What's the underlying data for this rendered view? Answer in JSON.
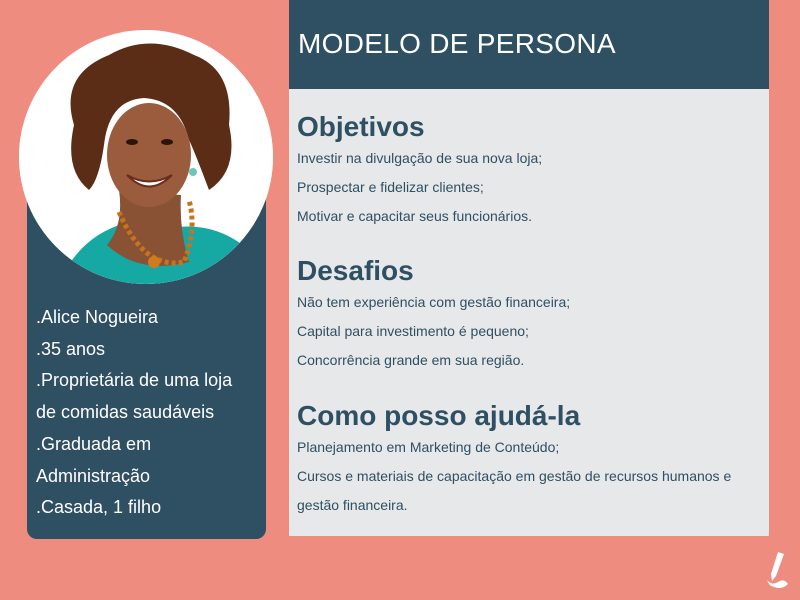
{
  "header": {
    "title": "MODELO DE PERSONA"
  },
  "profile": {
    "lines": [
      ".Alice Nogueira",
      ".35 anos",
      ".Proprietária de uma loja",
      "de comidas saudáveis",
      ".Graduada em",
      "Administração",
      ".Casada, 1 filho"
    ]
  },
  "sections": [
    {
      "heading": "Objetivos",
      "items": [
        "Investir na divulgação de sua nova loja;",
        "Prospectar e fidelizar clientes;",
        "Motivar e capacitar seus funcionários."
      ]
    },
    {
      "heading": "Desafios",
      "items": [
        "Não tem experiência com gestão financeira;",
        "Capital para investimento é pequeno;",
        "Concorrência grande em sua região."
      ]
    },
    {
      "heading": "Como posso ajudá-la",
      "items": [
        "Planejamento em Marketing de Conteúdo;",
        "Cursos e materiais de capacitação em gestão de recursos humanos e gestão financeira."
      ]
    }
  ],
  "colors": {
    "background": "#ef8c80",
    "navy": "#2f4f62",
    "panel": "#e6e8ea"
  },
  "icons": {
    "logo": "pen-brush-logo-icon"
  }
}
